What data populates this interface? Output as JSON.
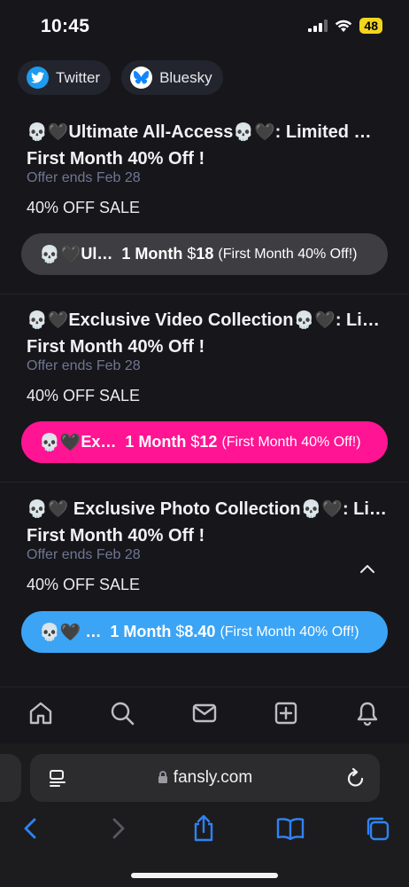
{
  "status_bar": {
    "time": "10:45",
    "battery": "48"
  },
  "social": [
    {
      "label": "Twitter",
      "icon": "twitter-bird-icon",
      "color": "#1d9bf0"
    },
    {
      "label": "Bluesky",
      "icon": "bluesky-butterfly-icon",
      "color": "#1185fe"
    }
  ],
  "offers": [
    {
      "title_line1": "Ultimate All-Access",
      "title_line1_suffix": ": Limited …",
      "title_line2": "First Month 40% Off !",
      "ends": "Offer ends Feb 28",
      "sale": "40% OFF SALE",
      "button": {
        "name": "Ul…",
        "months": "1 Month",
        "currency": "$",
        "price": "18",
        "note": "(First Month 40% Off!)",
        "color": "#3d3d42"
      }
    },
    {
      "title_line1": "Exclusive Video Collection",
      "title_line1_suffix": ": Li…",
      "title_line2": "First Month 40% Off !",
      "ends": "Offer ends Feb 28",
      "sale": "40% OFF SALE",
      "button": {
        "name": "Ex…",
        "months": "1 Month",
        "currency": "$",
        "price": "12",
        "note": "(First Month 40% Off!)",
        "color": "#ff1493"
      }
    },
    {
      "title_line1": " Exclusive Photo Collection",
      "title_line1_suffix": ": Li…",
      "title_line2": "First Month 40% Off !",
      "ends": "Offer ends Feb 28",
      "sale": "40% OFF SALE",
      "button": {
        "name": "…",
        "months": "1 Month",
        "currency": "$",
        "price": "8.40",
        "note": "(First Month 40% Off!)",
        "color": "#3ba4f5"
      }
    }
  ],
  "bottom_nav": [
    "home-icon",
    "search-icon",
    "mail-icon",
    "plus-square-icon",
    "bell-icon"
  ],
  "browser": {
    "url": "fansly.com"
  },
  "colors": {
    "background": "#16161b",
    "muted_text": "#6f7791",
    "chrome": "#1c1c1e"
  }
}
